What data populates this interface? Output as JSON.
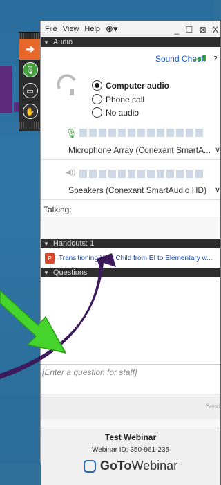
{
  "menu": {
    "file": "File",
    "view": "View",
    "help": "Help",
    "window_controls": "_ ☐ ⊠ X"
  },
  "audio": {
    "section_title": "Audio",
    "sound_check": "Sound Check",
    "options": [
      {
        "label": "Computer audio",
        "selected": true
      },
      {
        "label": "Phone call",
        "selected": false
      },
      {
        "label": "No audio",
        "selected": false
      }
    ],
    "microphone_device": "Microphone Array (Conexant SmartA...",
    "speaker_device": "Speakers (Conexant SmartAudio HD)",
    "talking_label": "Talking:"
  },
  "handouts": {
    "section_title": "Handouts: 1",
    "items": [
      {
        "title": "Transitioning Your Child from EI to Elementary w..."
      }
    ]
  },
  "questions": {
    "section_title": "Questions",
    "placeholder": "[Enter a question for staff]",
    "send_label": "Send"
  },
  "footer": {
    "title": "Test Webinar",
    "webinar_id": "Webinar ID: 350-961-235",
    "brand_goto": "GoTo",
    "brand_webinar": "Webinar"
  },
  "colors": {
    "accent_orange": "#e8672b",
    "mic_green": "#3f9e3a",
    "link_blue": "#2059c4",
    "arrow_green": "#45d42b",
    "arrow_purple": "#3c1a5c"
  }
}
